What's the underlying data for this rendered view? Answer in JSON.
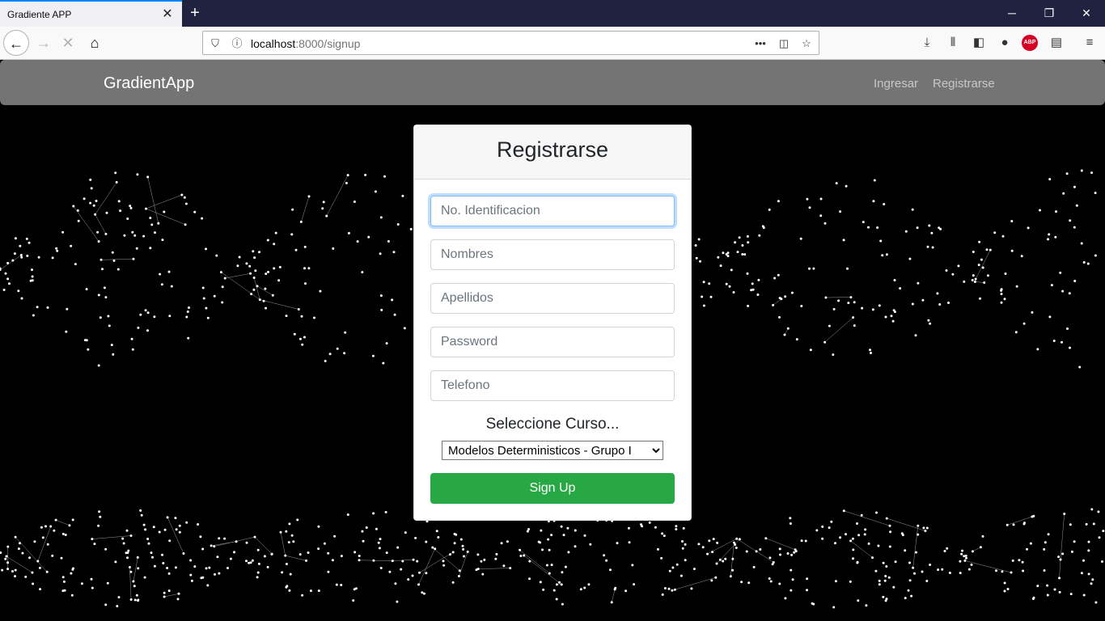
{
  "browser": {
    "tab_title": "Gradiente APP",
    "url_host": "localhost",
    "url_rest": ":8000/signup",
    "page_actions_label": "•••"
  },
  "app": {
    "brand": "GradientApp",
    "nav": {
      "login": "Ingresar",
      "register": "Registrarse"
    }
  },
  "form": {
    "title": "Registrarse",
    "fields": [
      {
        "placeholder": "No. Identificacion",
        "value": ""
      },
      {
        "placeholder": "Nombres",
        "value": ""
      },
      {
        "placeholder": "Apellidos",
        "value": ""
      },
      {
        "placeholder": "Password",
        "value": ""
      },
      {
        "placeholder": "Telefono",
        "value": ""
      }
    ],
    "select_label": "Seleccione Curso...",
    "select_value": "Modelos Deterministicos - Grupo I",
    "submit": "Sign Up"
  }
}
